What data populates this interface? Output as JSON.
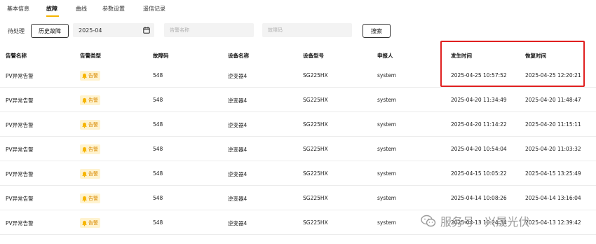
{
  "tabs": [
    {
      "label": "基本信息",
      "active": false
    },
    {
      "label": "故障",
      "active": true
    },
    {
      "label": "曲线",
      "active": false
    },
    {
      "label": "参数设置",
      "active": false
    },
    {
      "label": "遥信记录",
      "active": false
    }
  ],
  "filters": {
    "pending_label": "待处理",
    "history_label": "历史故障",
    "date_value": "2025-04",
    "alarm_name_placeholder": "告警名称",
    "fault_code_placeholder": "故障码",
    "search_label": "搜索"
  },
  "table": {
    "columns": [
      "告警名称",
      "告警类型",
      "故障码",
      "设备名称",
      "设备型号",
      "申报人",
      "发生时间",
      "恢复时间"
    ],
    "rows": [
      {
        "name": "PV异常告警",
        "type": "告警",
        "code": "548",
        "device": "逆变器4",
        "model": "SG225HX",
        "reporter": "system",
        "occurred": "2025-04-25 10:57:52",
        "recovered": "2025-04-25 12:20:21"
      },
      {
        "name": "PV异常告警",
        "type": "告警",
        "code": "548",
        "device": "逆变器4",
        "model": "SG225HX",
        "reporter": "system",
        "occurred": "2025-04-20 11:34:49",
        "recovered": "2025-04-20 11:48:47"
      },
      {
        "name": "PV异常告警",
        "type": "告警",
        "code": "548",
        "device": "逆变器4",
        "model": "SG225HX",
        "reporter": "system",
        "occurred": "2025-04-20 11:14:22",
        "recovered": "2025-04-20 11:15:11"
      },
      {
        "name": "PV异常告警",
        "type": "告警",
        "code": "548",
        "device": "逆变器4",
        "model": "SG225HX",
        "reporter": "system",
        "occurred": "2025-04-20 10:54:04",
        "recovered": "2025-04-20 11:03:32"
      },
      {
        "name": "PV异常告警",
        "type": "告警",
        "code": "548",
        "device": "逆变器4",
        "model": "SG225HX",
        "reporter": "system",
        "occurred": "2025-04-15 10:05:22",
        "recovered": "2025-04-15 13:25:49"
      },
      {
        "name": "PV异常告警",
        "type": "告警",
        "code": "548",
        "device": "逆变器4",
        "model": "SG225HX",
        "reporter": "system",
        "occurred": "2025-04-14 10:08:26",
        "recovered": "2025-04-14 13:16:04"
      },
      {
        "name": "PV异常告警",
        "type": "告警",
        "code": "548",
        "device": "逆变器4",
        "model": "SG225HX",
        "reporter": "system",
        "occurred": "2025-04-13 10:24:34",
        "recovered": "2025-04-13 12:39:42"
      }
    ]
  },
  "watermark": {
    "text": "服务号 · 兴晟光伏",
    "icon": "wechat-icon"
  },
  "colors": {
    "accent": "#f6b400",
    "highlight": "#e02020",
    "badge_bg": "#fff3cf",
    "badge_text": "#d98a00"
  }
}
